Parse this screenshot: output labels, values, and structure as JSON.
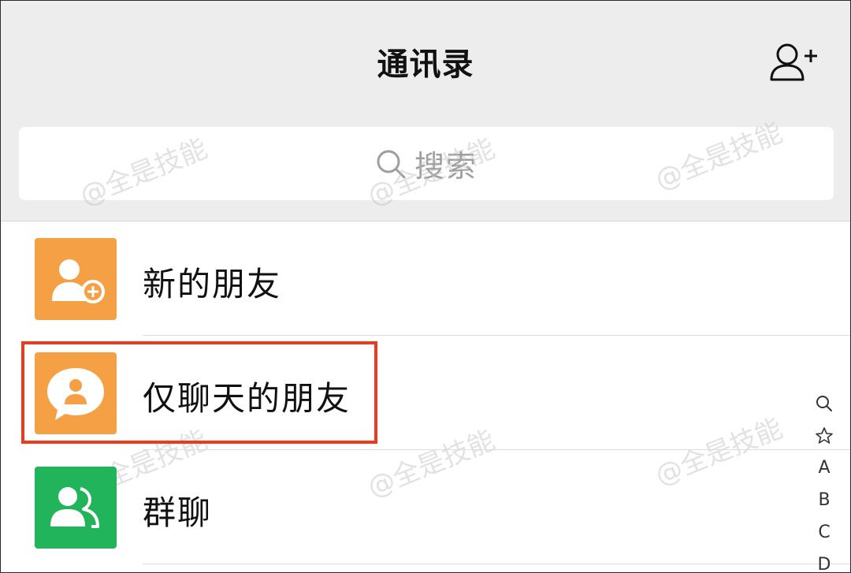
{
  "header": {
    "title": "通讯录",
    "add_contact_icon": "add-contact-icon"
  },
  "search": {
    "label": "搜索",
    "icon": "search-icon"
  },
  "list": {
    "items": [
      {
        "label": "新的朋友",
        "icon": "new-friend-icon",
        "color": "#f5a045"
      },
      {
        "label": "仅聊天的朋友",
        "icon": "chat-only-friend-icon",
        "color": "#f5a045"
      },
      {
        "label": "群聊",
        "icon": "group-chat-icon",
        "color": "#22b45a"
      }
    ]
  },
  "highlight_color": "#ee3a1c",
  "index_bar": [
    "A",
    "B",
    "C",
    "D"
  ],
  "watermark": "@全是技能"
}
